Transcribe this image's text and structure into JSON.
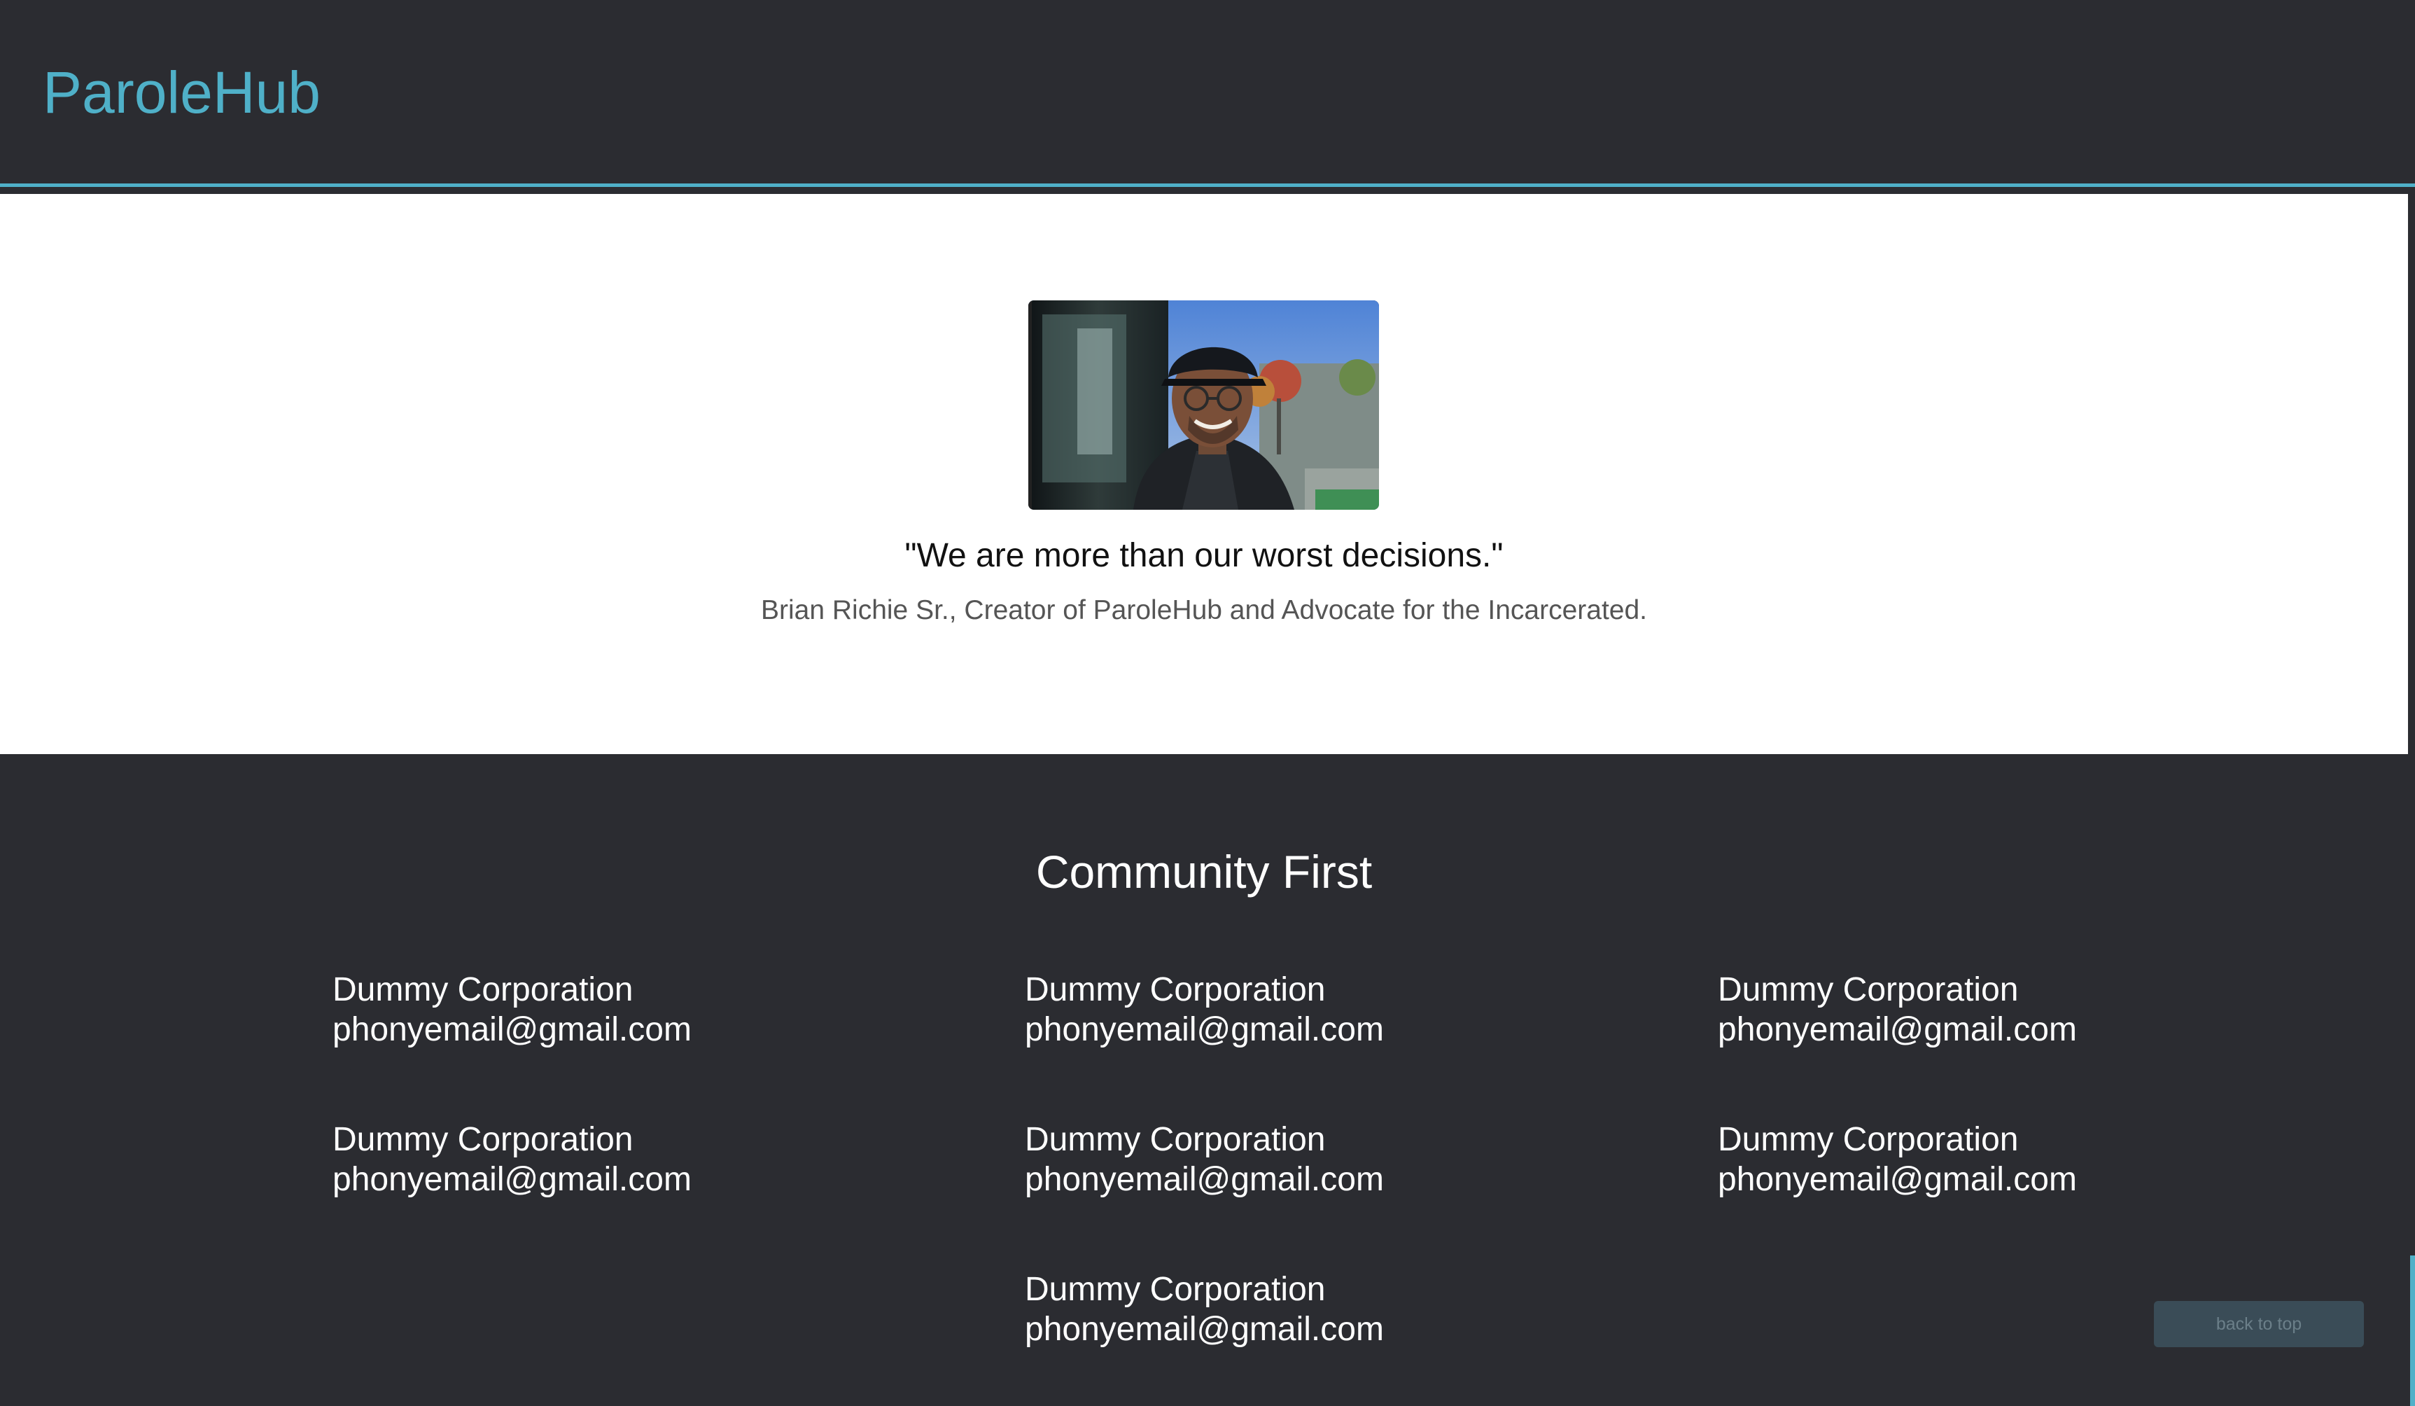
{
  "header": {
    "brand": "ParoleHub"
  },
  "hero": {
    "photo_alt": "Portrait of Brian Richie Sr.",
    "quote": "\"We are more than our worst decisions.\"",
    "attribution": "Brian Richie Sr., Creator of ParoleHub and Advocate for the Incarcerated."
  },
  "community": {
    "title": "Community First",
    "contacts": [
      {
        "name": "Dummy Corporation",
        "email": "phonyemail@gmail.com"
      },
      {
        "name": "Dummy Corporation",
        "email": "phonyemail@gmail.com"
      },
      {
        "name": "Dummy Corporation",
        "email": "phonyemail@gmail.com"
      },
      {
        "name": "Dummy Corporation",
        "email": "phonyemail@gmail.com"
      },
      {
        "name": "Dummy Corporation",
        "email": "phonyemail@gmail.com"
      },
      {
        "name": "Dummy Corporation",
        "email": "phonyemail@gmail.com"
      },
      {
        "name": "Dummy Corporation",
        "email": "phonyemail@gmail.com"
      }
    ]
  },
  "footer": {
    "back_to_top": "back to top"
  },
  "colors": {
    "accent": "#4fb0c8",
    "dark_bg": "#2b2c31",
    "hero_bg": "#ffffff"
  }
}
